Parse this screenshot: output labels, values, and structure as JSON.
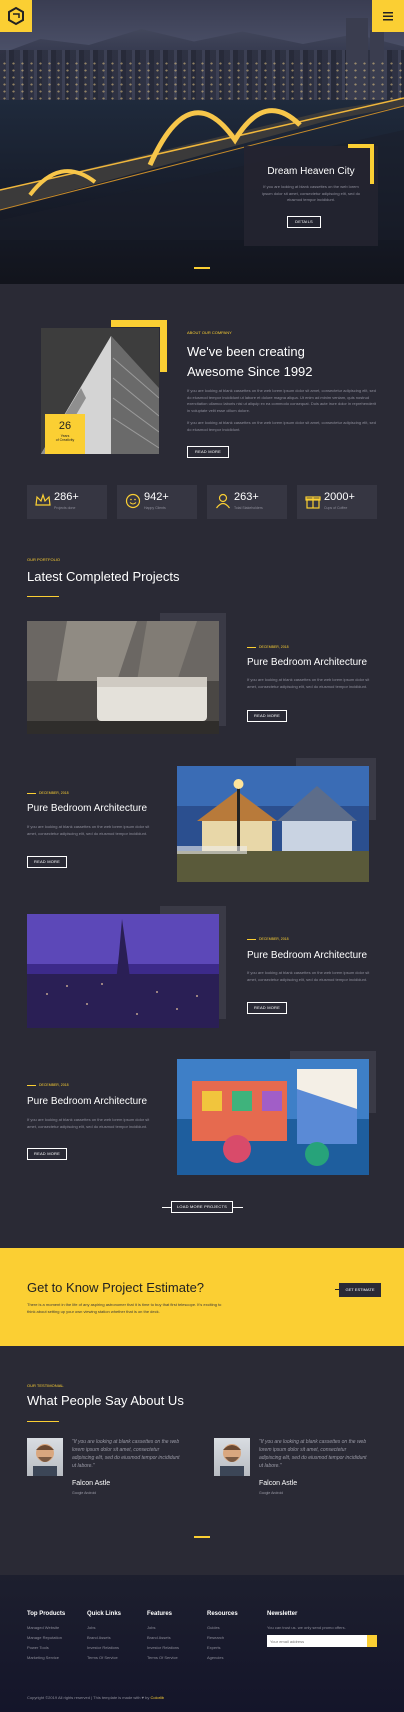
{
  "header": {
    "menu_icon": "menu-icon",
    "logo_icon": "hex-logo-icon"
  },
  "hero": {
    "title": "Dream Heaven City",
    "text": "If you are looking at blank cassettes on the web lorem ipsum dolor sit amet, consectetur adipiscing elit, sed do eiusmod tempor incididunt.",
    "button": "DETAILS"
  },
  "about": {
    "eyebrow": "ABOUT OUR COMPANY",
    "title_line1": "We've been creating",
    "title_line2": "Awesome Since 1992",
    "para1": "If you are looking at blank cassettes on the web lorem ipsum dolor sit amet, consectetur adipiscing elit, sed do eiusmod tempor incididunt ut labore et dolore magna aliqua. Ut enim ad minim veniam, quis nostrud exercitation ullamco laboris nisi ut aliquip ex ea commodo consequat. Duis aute irure dolor in reprehenderit in voluptate velit esse cillum dolore.",
    "para2": "If you are looking at blank cassettes on the web lorem ipsum dolor sit amet, consectetur adipiscing elit, sed do eiusmod tempor incididunt.",
    "button": "READ MORE",
    "badge_number": "26",
    "badge_line1": "Years",
    "badge_line2": "of Creativity"
  },
  "stats": [
    {
      "icon": "crown-icon",
      "value": "286+",
      "label": "Projects done"
    },
    {
      "icon": "smile-icon",
      "value": "942+",
      "label": "Happy Clients"
    },
    {
      "icon": "user-icon",
      "value": "263+",
      "label": "Total Stakeholders"
    },
    {
      "icon": "gift-icon",
      "value": "2000+",
      "label": "Cups of Coffee"
    }
  ],
  "portfolio": {
    "eyebrow": "OUR PORTFOLIO",
    "title": "Latest Completed Projects",
    "load_more": "LOAD MORE PROJECTS"
  },
  "projects": [
    {
      "date": "DECEMBER, 2018",
      "title": "Pure Bedroom Architecture",
      "text": "If you are looking at blank cassettes on the web lorem ipsum dolor sit amet, consectetur adipiscing elit, sed do eiusmod tempor incididunt.",
      "button": "READ MORE"
    },
    {
      "date": "DECEMBER, 2018",
      "title": "Pure Bedroom Architecture",
      "text": "If you are looking at blank cassettes on the web lorem ipsum dolor sit amet, consectetur adipiscing elit, sed do eiusmod tempor incididunt.",
      "button": "READ MORE"
    },
    {
      "date": "DECEMBER, 2018",
      "title": "Pure Bedroom Architecture",
      "text": "If you are looking at blank cassettes on the web lorem ipsum dolor sit amet, consectetur adipiscing elit, sed do eiusmod tempor incididunt.",
      "button": "READ MORE"
    },
    {
      "date": "DECEMBER, 2018",
      "title": "Pure Bedroom Architecture",
      "text": "If you are looking at blank cassettes on the web lorem ipsum dolor sit amet, consectetur adipiscing elit, sed do eiusmod tempor incididunt.",
      "button": "READ MORE"
    }
  ],
  "estimate": {
    "title": "Get to Know Project Estimate?",
    "text": "There is a moment in the life of any aspiring astronomer that it is time to buy that first telescope. It's exciting to think about setting up your own viewing station whether that is on the deck.",
    "button": "GET ESTIMATE"
  },
  "testimonials": {
    "eyebrow": "OUR TESTIMONIAL",
    "title": "What People Say About Us",
    "items": [
      {
        "quote": "\"If you are looking at blank cassettes on the web lorem ipsum dolor sit amet, consectetur adipiscing elit, sed do eiusmod tempor incididunt ut labore.\"",
        "name": "Falcon Astle",
        "role": "Google Android"
      },
      {
        "quote": "\"If you are looking at blank cassettes on the web lorem ipsum dolor sit amet, consectetur adipiscing elit, sed do eiusmod tempor incididunt ut labore.\"",
        "name": "Falcon Astle",
        "role": "Google Android"
      }
    ]
  },
  "footer": {
    "columns": [
      {
        "title": "Top Products",
        "items": [
          "Managed Website",
          "Manage Reputation",
          "Power Tools",
          "Marketing Service"
        ]
      },
      {
        "title": "Quick Links",
        "items": [
          "Jobs",
          "Brand Assets",
          "Investor Relations",
          "Terms Of Service"
        ]
      },
      {
        "title": "Features",
        "items": [
          "Jobs",
          "Brand Assets",
          "Investor Relations",
          "Terms Of Service"
        ]
      },
      {
        "title": "Resources",
        "items": [
          "Guides",
          "Research",
          "Experts",
          "Agencies"
        ]
      }
    ],
    "newsletter_title": "Newsletter",
    "newsletter_text": "You can trust us. we only send promo offers.",
    "email_placeholder": "Your email address",
    "copyright": "Copyright ©2019 All rights reserved | This template is made with ♥ by",
    "brand": "Colorlib"
  }
}
